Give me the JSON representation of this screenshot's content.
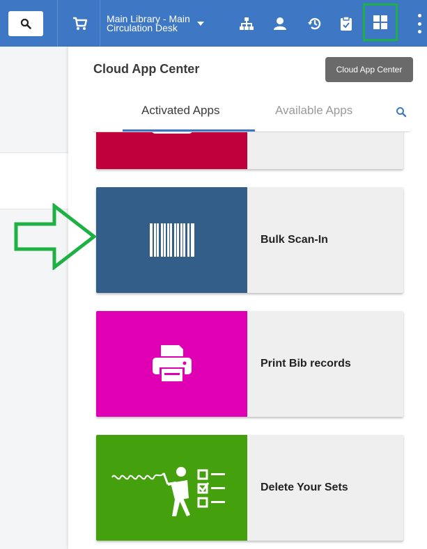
{
  "topbar": {
    "library_name": "Main Library - Main\nCirculation Desk",
    "icons": [
      "search-icon",
      "cart-icon",
      "caret-down-icon",
      "sitemap-icon",
      "user-icon",
      "history-icon",
      "clipboard-check-icon",
      "cloud-app-center-icon",
      "more-vertical-icon"
    ],
    "accent_color": "#3e78c4",
    "highlight_color": "#1db043"
  },
  "panel": {
    "title": "Cloud App Center",
    "tooltip": "Cloud App Center",
    "tabs": [
      {
        "label": "Activated Apps",
        "active": true
      },
      {
        "label": "Available Apps",
        "active": false
      }
    ]
  },
  "apps": [
    {
      "name": "",
      "color": "#c0003a",
      "icon": "calendar-icon"
    },
    {
      "name": "Bulk Scan-In",
      "color": "#345e8a",
      "icon": "barcode-icon"
    },
    {
      "name": "Print Bib records",
      "color": "#e000b4",
      "icon": "printer-icon"
    },
    {
      "name": "Delete Your Sets",
      "color": "#45a00e",
      "icon": "whip-checklist-icon"
    }
  ],
  "annotation": {
    "arrow_color": "#1db043",
    "icon": "arrow-right-outline-icon"
  }
}
